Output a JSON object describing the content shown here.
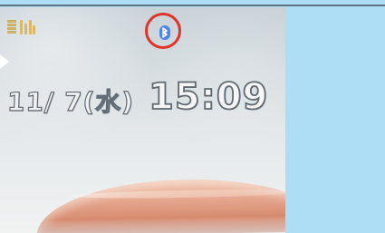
{
  "status": {
    "battery_icon": "battery-icon",
    "signal_icon": "signal-icon",
    "bluetooth_icon": "bluetooth-icon",
    "bluetooth_highlight_color": "#e0342a"
  },
  "screen": {
    "date": "11/ 7(水)",
    "time": "15:09"
  },
  "colors": {
    "page_background": "#aedef6",
    "status_icon": "#d8b96a",
    "bluetooth": "#4b86e8"
  }
}
